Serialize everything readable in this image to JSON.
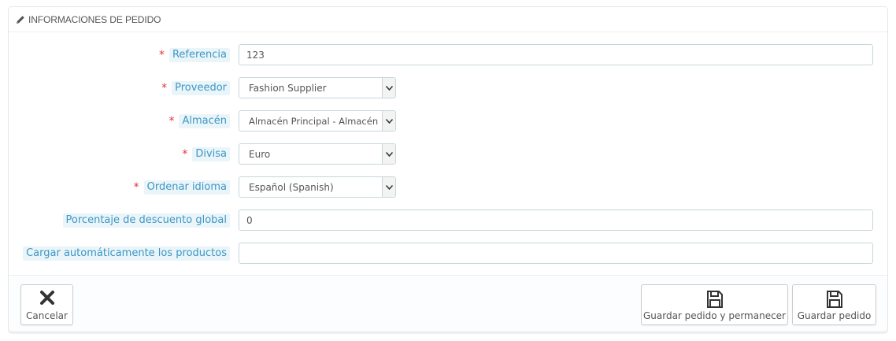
{
  "panel": {
    "title": "INFORMACIONES DE PEDIDO",
    "title_icon": "pencil-icon"
  },
  "form": {
    "reference": {
      "label": "Referencia",
      "required": true,
      "value": "123"
    },
    "supplier": {
      "label": "Proveedor",
      "required": true,
      "value": "Fashion Supplier"
    },
    "warehouse": {
      "label": "Almacén",
      "required": true,
      "value": "Almacén Principal - Almacén"
    },
    "currency": {
      "label": "Divisa",
      "required": true,
      "value": "Euro"
    },
    "language": {
      "label": "Ordenar idioma",
      "required": true,
      "value": "Español (Spanish)"
    },
    "discount": {
      "label": "Porcentaje de descuento global",
      "required": false,
      "value": "0"
    },
    "autoload": {
      "label": "Cargar automáticamente los productos",
      "required": false,
      "value": ""
    },
    "required_marker": "*"
  },
  "footer": {
    "cancel_label": "Cancelar",
    "cancel_icon": "close-icon",
    "save_stay_label": "Guardar pedido y permanecer",
    "save_label": "Guardar pedido",
    "save_icon": "floppy-disk-icon"
  },
  "colors": {
    "label_text": "#3d96c4",
    "label_bg": "#eaf5fa",
    "required": "#e3323d"
  }
}
